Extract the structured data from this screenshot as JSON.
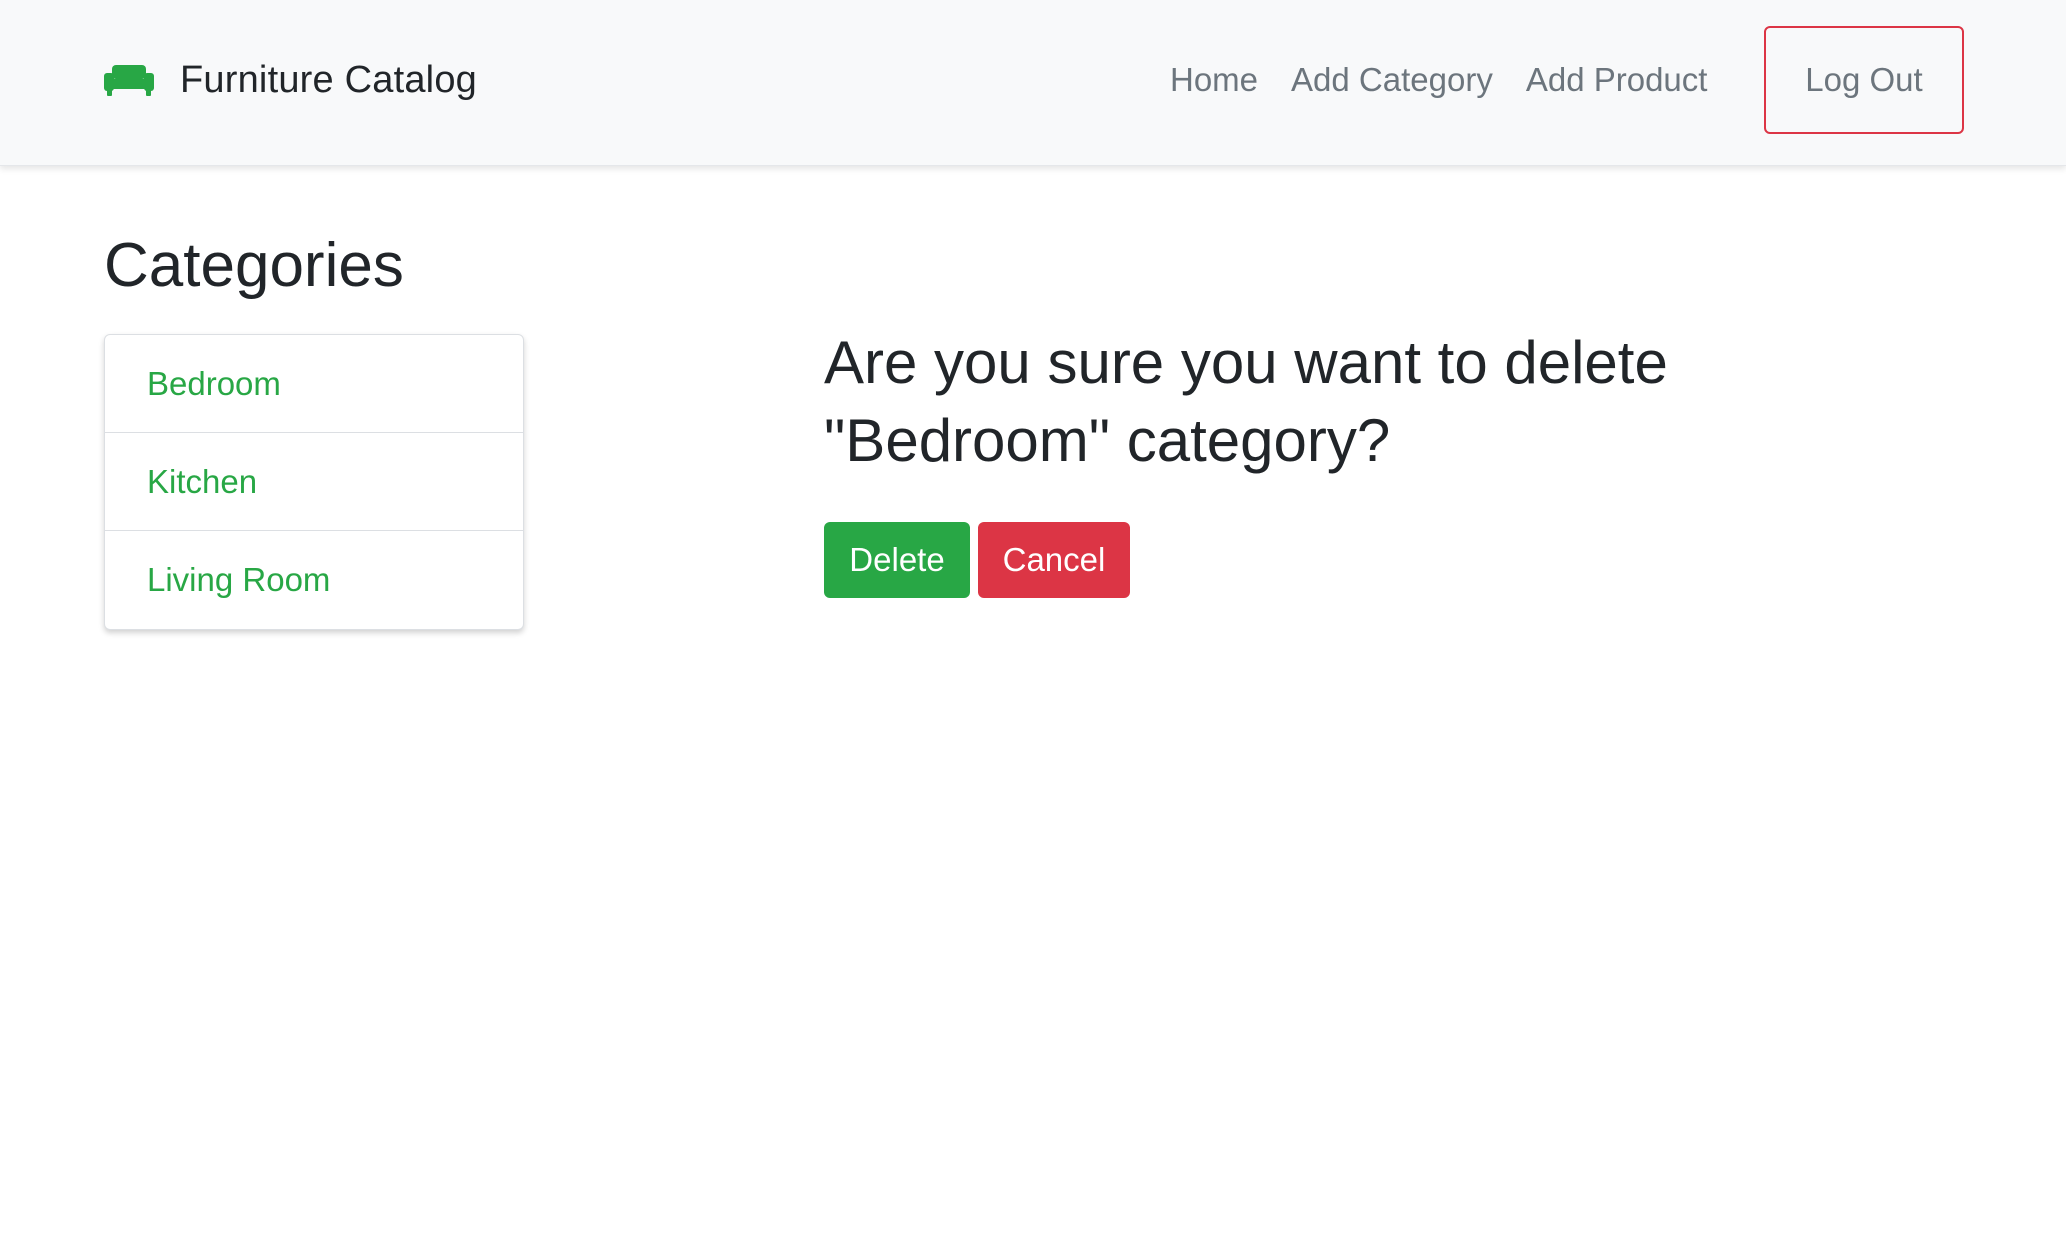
{
  "navbar": {
    "brand": {
      "icon": "couch-icon",
      "icon_color": "#28a745",
      "title": "Furniture Catalog"
    },
    "links": [
      {
        "label": "Home"
      },
      {
        "label": "Add Category"
      },
      {
        "label": "Add Product"
      }
    ],
    "logout": {
      "label": "Log Out",
      "border_color": "#dc3545"
    }
  },
  "sidebar": {
    "title": "Categories",
    "categories": [
      {
        "label": "Bedroom"
      },
      {
        "label": "Kitchen"
      },
      {
        "label": "Living Room"
      }
    ],
    "link_color": "#28a745"
  },
  "confirm": {
    "heading": "Are you sure you want to delete \"Bedroom\" category?",
    "delete_label": "Delete",
    "cancel_label": "Cancel",
    "delete_color": "#28a745",
    "cancel_color": "#dc3545"
  }
}
